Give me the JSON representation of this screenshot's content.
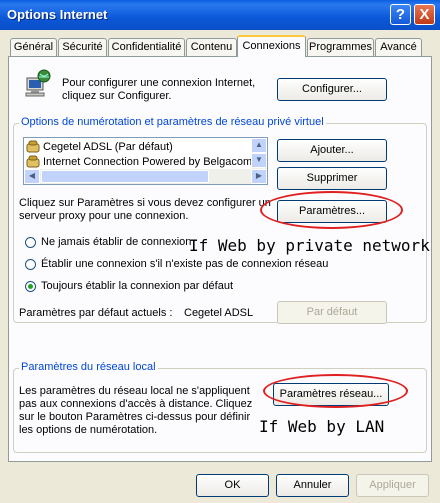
{
  "window": {
    "title": "Options Internet",
    "help_glyph": "?",
    "close_glyph": "X"
  },
  "tabs": [
    {
      "label": "Général"
    },
    {
      "label": "Sécurité"
    },
    {
      "label": "Confidentialité"
    },
    {
      "label": "Contenu"
    },
    {
      "label": "Connexions",
      "active": true
    },
    {
      "label": "Programmes"
    },
    {
      "label": "Avancé"
    }
  ],
  "setup": {
    "text": "Pour configurer une connexion Internet, cliquez sur Configurer.",
    "button": "Configurer..."
  },
  "dialup": {
    "legend": "Options de numérotation et paramètres de réseau privé virtuel",
    "connections": [
      {
        "label": "Cegetel ADSL (Par défaut)"
      },
      {
        "label": "Internet Connection Powered by Belgacom"
      }
    ],
    "add_button": "Ajouter...",
    "remove_button": "Supprimer",
    "proxy_text": "Cliquez sur Paramètres si vous devez configurer un serveur proxy pour une connexion.",
    "settings_button": "Paramètres...",
    "radio_options": [
      {
        "label": "Ne jamais établir de connexion",
        "checked": false
      },
      {
        "label": "Établir une connexion s'il n'existe pas de connexion réseau",
        "checked": false
      },
      {
        "label": "Toujours établir la connexion par défaut",
        "checked": true
      }
    ],
    "current_default_label": "Paramètres par défaut actuels :",
    "current_default_value": "Cegetel ADSL",
    "set_default_button": "Par défaut"
  },
  "lan": {
    "legend": "Paramètres du réseau local",
    "text": "Les paramètres du réseau local ne s'appliquent pas aux connexions d'accès à distance. Cliquez sur le bouton Paramètres ci-dessus pour définir les options de numérotation.",
    "button": "Paramètres réseau..."
  },
  "annotations": {
    "private_network": "If Web by private network",
    "lan": "If Web by LAN",
    "color": "#e02020"
  },
  "footer": {
    "ok": "OK",
    "cancel": "Annuler",
    "apply": "Appliquer"
  }
}
